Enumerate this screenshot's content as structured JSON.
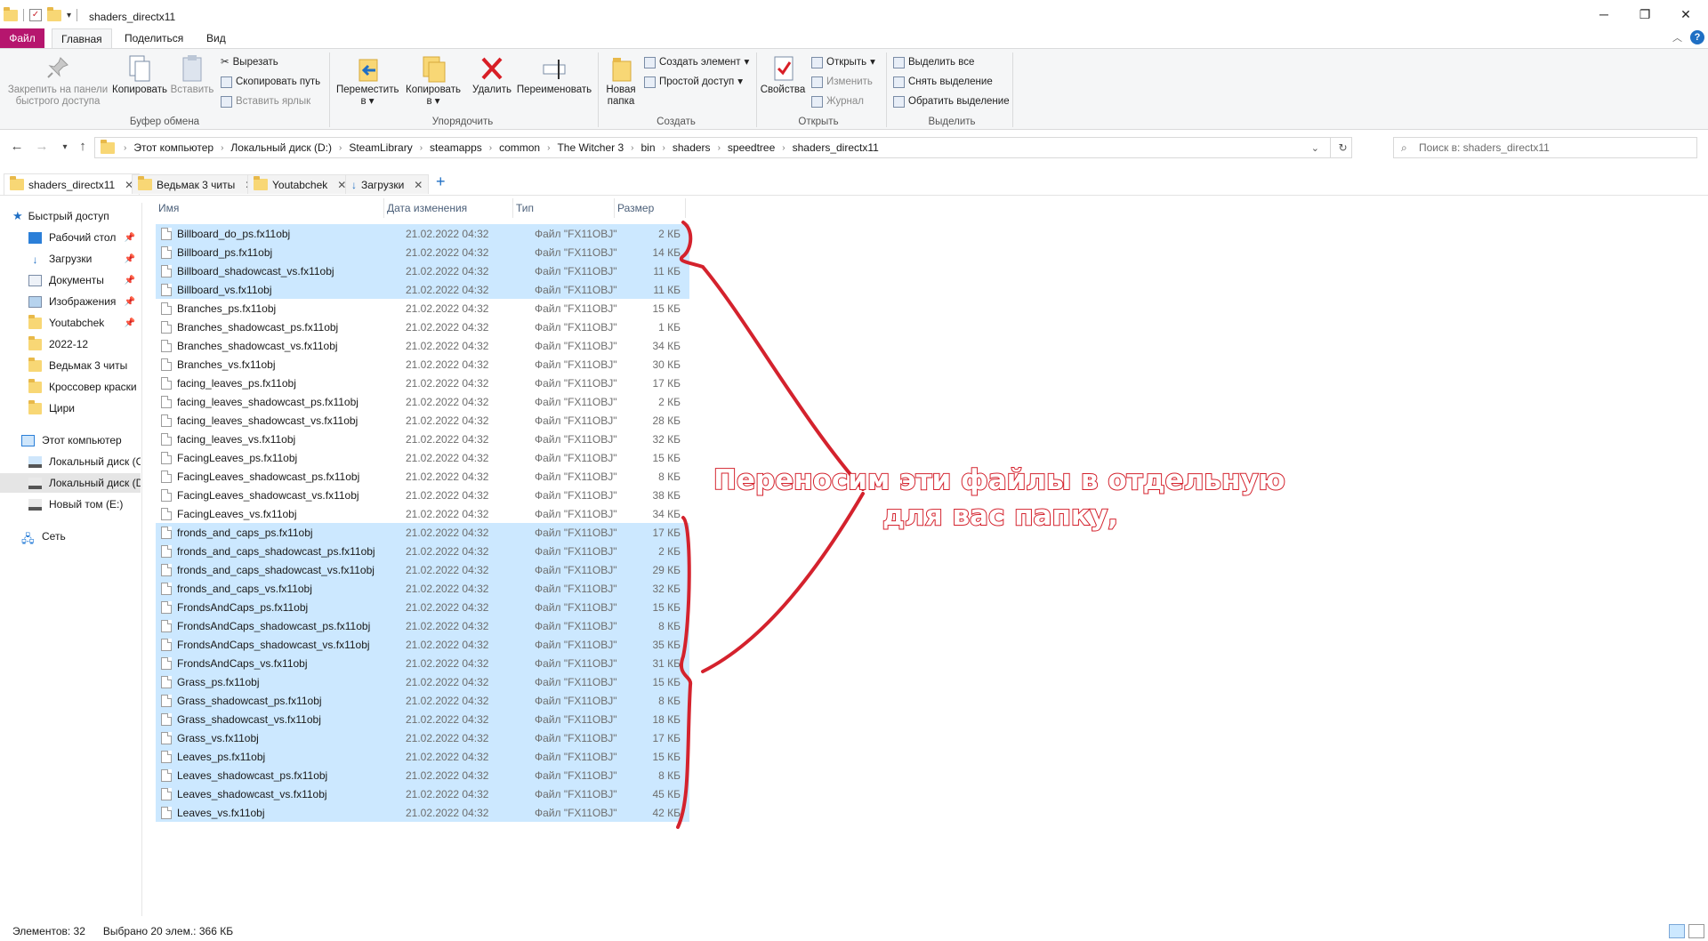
{
  "window": {
    "title": "shaders_directx11",
    "min_icon": "minimize-icon",
    "max_icon": "restore-icon",
    "close_icon": "close-icon"
  },
  "ribbon_tabs": [
    "Файл",
    "Главная",
    "Поделиться",
    "Вид"
  ],
  "ribbon": {
    "pin_label": "Закрепить на панели быстрого доступа",
    "copy_label": "Копировать",
    "paste_label": "Вставить",
    "cut_label": "Вырезать",
    "copy_path_label": "Скопировать путь",
    "paste_shortcut_label": "Вставить ярлык",
    "clipboard_group": "Буфер обмена",
    "move_to_label": "Переместить в",
    "copy_to_label": "Копировать в",
    "delete_label": "Удалить",
    "rename_label": "Переименовать",
    "organize_group": "Упорядочить",
    "new_folder_label": "Новая папка",
    "new_item_label": "Создать элемент",
    "easy_access_label": "Простой доступ",
    "new_group": "Создать",
    "properties_label": "Свойства",
    "open_label": "Открыть",
    "edit_label": "Изменить",
    "history_label": "Журнал",
    "open_group": "Открыть",
    "select_all_label": "Выделить все",
    "select_none_label": "Снять выделение",
    "invert_label": "Обратить выделение",
    "select_group": "Выделить"
  },
  "address": {
    "crumbs": [
      "Этот компьютер",
      "Локальный диск (D:)",
      "SteamLibrary",
      "steamapps",
      "common",
      "The Witcher 3",
      "bin",
      "shaders",
      "speedtree",
      "shaders_directx11"
    ],
    "search_placeholder": "Поиск в: shaders_directx11"
  },
  "tabs": [
    "shaders_directx11",
    "Ведьмак 3 читы",
    "Youtabchek",
    "Загрузки"
  ],
  "nav": {
    "quick_access": "Быстрый доступ",
    "items": [
      "Рабочий стол",
      "Загрузки",
      "Документы",
      "Изображения",
      "Youtabchek",
      "2022-12",
      "Ведьмак 3 читы",
      "Кроссовер краски",
      "Цири"
    ],
    "this_pc": "Этот компьютер",
    "drives": [
      "Локальный диск (C:)",
      "Локальный диск (D:)",
      "Новый том (E:)"
    ],
    "network": "Сеть"
  },
  "columns": {
    "name": "Имя",
    "date": "Дата изменения",
    "type": "Тип",
    "size": "Размер"
  },
  "files": [
    {
      "name": "Billboard_do_ps.fx11obj",
      "date": "21.02.2022 04:32",
      "type": "Файл \"FX11OBJ\"",
      "size": "2 КБ",
      "selected": true
    },
    {
      "name": "Billboard_ps.fx11obj",
      "date": "21.02.2022 04:32",
      "type": "Файл \"FX11OBJ\"",
      "size": "14 КБ",
      "selected": true
    },
    {
      "name": "Billboard_shadowcast_vs.fx11obj",
      "date": "21.02.2022 04:32",
      "type": "Файл \"FX11OBJ\"",
      "size": "11 КБ",
      "selected": true
    },
    {
      "name": "Billboard_vs.fx11obj",
      "date": "21.02.2022 04:32",
      "type": "Файл \"FX11OBJ\"",
      "size": "11 КБ",
      "selected": true
    },
    {
      "name": "Branches_ps.fx11obj",
      "date": "21.02.2022 04:32",
      "type": "Файл \"FX11OBJ\"",
      "size": "15 КБ",
      "selected": false
    },
    {
      "name": "Branches_shadowcast_ps.fx11obj",
      "date": "21.02.2022 04:32",
      "type": "Файл \"FX11OBJ\"",
      "size": "1 КБ",
      "selected": false
    },
    {
      "name": "Branches_shadowcast_vs.fx11obj",
      "date": "21.02.2022 04:32",
      "type": "Файл \"FX11OBJ\"",
      "size": "34 КБ",
      "selected": false
    },
    {
      "name": "Branches_vs.fx11obj",
      "date": "21.02.2022 04:32",
      "type": "Файл \"FX11OBJ\"",
      "size": "30 КБ",
      "selected": false
    },
    {
      "name": "facing_leaves_ps.fx11obj",
      "date": "21.02.2022 04:32",
      "type": "Файл \"FX11OBJ\"",
      "size": "17 КБ",
      "selected": false
    },
    {
      "name": "facing_leaves_shadowcast_ps.fx11obj",
      "date": "21.02.2022 04:32",
      "type": "Файл \"FX11OBJ\"",
      "size": "2 КБ",
      "selected": false
    },
    {
      "name": "facing_leaves_shadowcast_vs.fx11obj",
      "date": "21.02.2022 04:32",
      "type": "Файл \"FX11OBJ\"",
      "size": "28 КБ",
      "selected": false
    },
    {
      "name": "facing_leaves_vs.fx11obj",
      "date": "21.02.2022 04:32",
      "type": "Файл \"FX11OBJ\"",
      "size": "32 КБ",
      "selected": false
    },
    {
      "name": "FacingLeaves_ps.fx11obj",
      "date": "21.02.2022 04:32",
      "type": "Файл \"FX11OBJ\"",
      "size": "15 КБ",
      "selected": false
    },
    {
      "name": "FacingLeaves_shadowcast_ps.fx11obj",
      "date": "21.02.2022 04:32",
      "type": "Файл \"FX11OBJ\"",
      "size": "8 КБ",
      "selected": false
    },
    {
      "name": "FacingLeaves_shadowcast_vs.fx11obj",
      "date": "21.02.2022 04:32",
      "type": "Файл \"FX11OBJ\"",
      "size": "38 КБ",
      "selected": false
    },
    {
      "name": "FacingLeaves_vs.fx11obj",
      "date": "21.02.2022 04:32",
      "type": "Файл \"FX11OBJ\"",
      "size": "34 КБ",
      "selected": false
    },
    {
      "name": "fronds_and_caps_ps.fx11obj",
      "date": "21.02.2022 04:32",
      "type": "Файл \"FX11OBJ\"",
      "size": "17 КБ",
      "selected": true
    },
    {
      "name": "fronds_and_caps_shadowcast_ps.fx11obj",
      "date": "21.02.2022 04:32",
      "type": "Файл \"FX11OBJ\"",
      "size": "2 КБ",
      "selected": true
    },
    {
      "name": "fronds_and_caps_shadowcast_vs.fx11obj",
      "date": "21.02.2022 04:32",
      "type": "Файл \"FX11OBJ\"",
      "size": "29 КБ",
      "selected": true
    },
    {
      "name": "fronds_and_caps_vs.fx11obj",
      "date": "21.02.2022 04:32",
      "type": "Файл \"FX11OBJ\"",
      "size": "32 КБ",
      "selected": true
    },
    {
      "name": "FrondsAndCaps_ps.fx11obj",
      "date": "21.02.2022 04:32",
      "type": "Файл \"FX11OBJ\"",
      "size": "15 КБ",
      "selected": true
    },
    {
      "name": "FrondsAndCaps_shadowcast_ps.fx11obj",
      "date": "21.02.2022 04:32",
      "type": "Файл \"FX11OBJ\"",
      "size": "8 КБ",
      "selected": true
    },
    {
      "name": "FrondsAndCaps_shadowcast_vs.fx11obj",
      "date": "21.02.2022 04:32",
      "type": "Файл \"FX11OBJ\"",
      "size": "35 КБ",
      "selected": true
    },
    {
      "name": "FrondsAndCaps_vs.fx11obj",
      "date": "21.02.2022 04:32",
      "type": "Файл \"FX11OBJ\"",
      "size": "31 КБ",
      "selected": true
    },
    {
      "name": "Grass_ps.fx11obj",
      "date": "21.02.2022 04:32",
      "type": "Файл \"FX11OBJ\"",
      "size": "15 КБ",
      "selected": true
    },
    {
      "name": "Grass_shadowcast_ps.fx11obj",
      "date": "21.02.2022 04:32",
      "type": "Файл \"FX11OBJ\"",
      "size": "8 КБ",
      "selected": true
    },
    {
      "name": "Grass_shadowcast_vs.fx11obj",
      "date": "21.02.2022 04:32",
      "type": "Файл \"FX11OBJ\"",
      "size": "18 КБ",
      "selected": true
    },
    {
      "name": "Grass_vs.fx11obj",
      "date": "21.02.2022 04:32",
      "type": "Файл \"FX11OBJ\"",
      "size": "17 КБ",
      "selected": true
    },
    {
      "name": "Leaves_ps.fx11obj",
      "date": "21.02.2022 04:32",
      "type": "Файл \"FX11OBJ\"",
      "size": "15 КБ",
      "selected": true
    },
    {
      "name": "Leaves_shadowcast_ps.fx11obj",
      "date": "21.02.2022 04:32",
      "type": "Файл \"FX11OBJ\"",
      "size": "8 КБ",
      "selected": true
    },
    {
      "name": "Leaves_shadowcast_vs.fx11obj",
      "date": "21.02.2022 04:32",
      "type": "Файл \"FX11OBJ\"",
      "size": "45 КБ",
      "selected": true
    },
    {
      "name": "Leaves_vs.fx11obj",
      "date": "21.02.2022 04:32",
      "type": "Файл \"FX11OBJ\"",
      "size": "42 КБ",
      "selected": true
    }
  ],
  "annotation": {
    "line1": "Переносим эти файлы в отдельную",
    "line2": "для вас папку,",
    "color": "#d4222d"
  },
  "status": {
    "count": "Элементов: 32",
    "selected": "Выбрано 20 элем.: 366 КБ"
  },
  "colors": {
    "accent_file_tab": "#b6166e",
    "selection": "#cce8ff",
    "folder": "#f8d775"
  }
}
